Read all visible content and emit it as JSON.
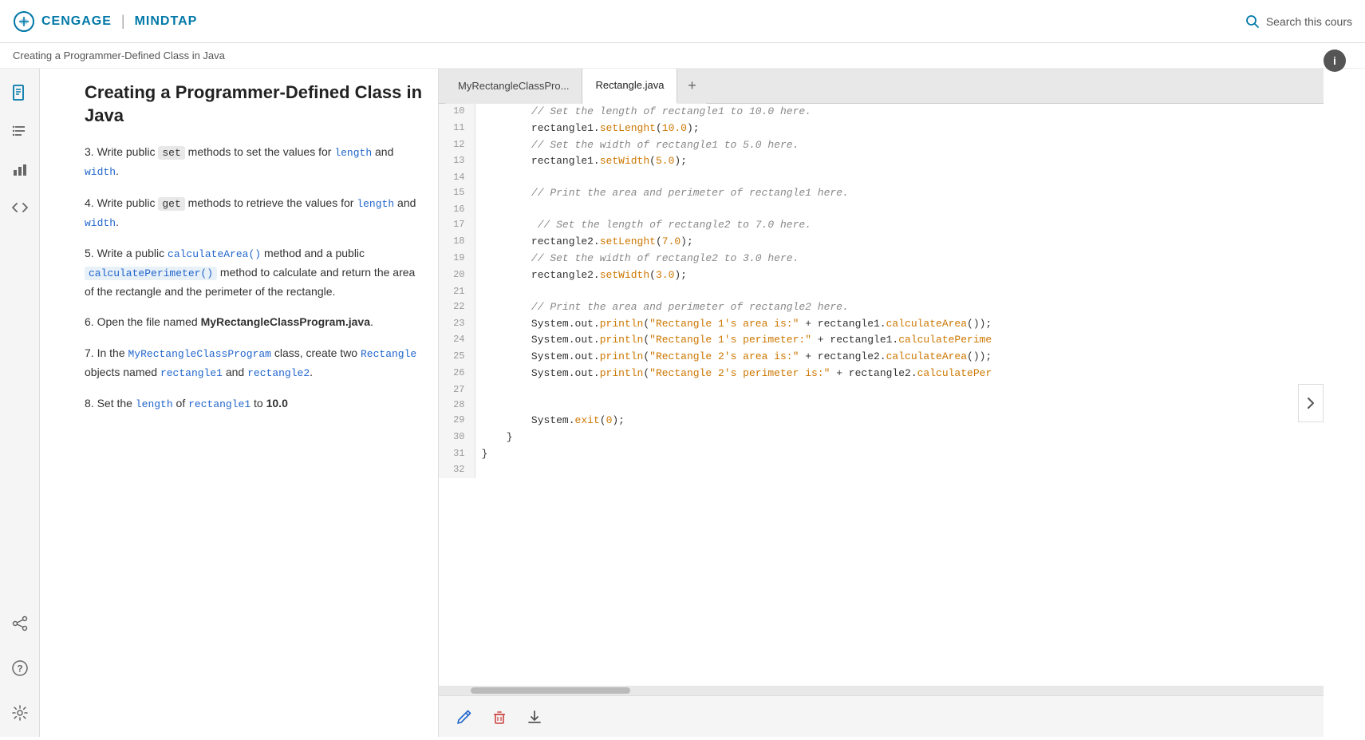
{
  "header": {
    "logo_cengage": "CENGAGE",
    "logo_mindtap": "MINDTAP",
    "search_placeholder": "Search this cours"
  },
  "breadcrumb": {
    "text": "Creating a Programmer-Defined Class in Java"
  },
  "content": {
    "title": "Creating a Programmer-Defined Class in Java",
    "items": [
      {
        "number": "3",
        "text_parts": [
          {
            "type": "text",
            "val": "Write public "
          },
          {
            "type": "code",
            "val": "set"
          },
          {
            "type": "text",
            "val": " methods to set the values for "
          },
          {
            "type": "blue",
            "val": "length"
          },
          {
            "type": "text",
            "val": " and "
          },
          {
            "type": "blue",
            "val": "width"
          },
          {
            "type": "text",
            "val": "."
          }
        ]
      },
      {
        "number": "4",
        "text_parts": [
          {
            "type": "text",
            "val": "Write public "
          },
          {
            "type": "code",
            "val": "get"
          },
          {
            "type": "text",
            "val": " methods to retrieve the values for "
          },
          {
            "type": "blue",
            "val": "length"
          },
          {
            "type": "text",
            "val": " and "
          },
          {
            "type": "blue",
            "val": "width"
          },
          {
            "type": "text",
            "val": "."
          }
        ]
      },
      {
        "number": "5",
        "text_parts": [
          {
            "type": "text",
            "val": "Write a public "
          },
          {
            "type": "blue-code",
            "val": "calculateArea()"
          },
          {
            "type": "text",
            "val": " method and a public "
          },
          {
            "type": "blue-code-block",
            "val": "calculatePerimeter()"
          },
          {
            "type": "text",
            "val": " method to calculate and return the area of the rectangle and the perimeter of the rectangle."
          }
        ]
      },
      {
        "number": "6",
        "text_parts": [
          {
            "type": "text",
            "val": "Open the file named "
          },
          {
            "type": "bold",
            "val": "MyRectangleClassProgram.java"
          },
          {
            "type": "text",
            "val": "."
          }
        ]
      },
      {
        "number": "7",
        "text_parts": [
          {
            "type": "text",
            "val": "In the "
          },
          {
            "type": "blue",
            "val": "MyRectangleClassProgram"
          },
          {
            "type": "text",
            "val": " class, create two "
          },
          {
            "type": "blue",
            "val": "Rectangle"
          },
          {
            "type": "text",
            "val": " objects named "
          },
          {
            "type": "blue",
            "val": "rectangle1"
          },
          {
            "type": "text",
            "val": " and "
          },
          {
            "type": "blue",
            "val": "rectangle2"
          },
          {
            "type": "text",
            "val": "."
          }
        ]
      },
      {
        "number": "8",
        "text_parts": [
          {
            "type": "text",
            "val": "Set the "
          },
          {
            "type": "blue",
            "val": "length"
          },
          {
            "type": "text",
            "val": " of "
          },
          {
            "type": "blue",
            "val": "rectangle1"
          },
          {
            "type": "text",
            "val": " to "
          },
          {
            "type": "bold",
            "val": "10.0"
          }
        ]
      }
    ]
  },
  "tabs": [
    {
      "label": "MyRectangleClassPro...",
      "active": false
    },
    {
      "label": "Rectangle.java",
      "active": true
    }
  ],
  "tab_add": "+",
  "code_lines": [
    {
      "num": "10",
      "code": [
        {
          "type": "comment",
          "val": "        // Set the length of rectangle1 to 10.0 here."
        }
      ]
    },
    {
      "num": "11",
      "code": [
        {
          "type": "default",
          "val": "        rectangle1."
        },
        {
          "type": "method",
          "val": "setLenght"
        },
        {
          "type": "default",
          "val": "("
        },
        {
          "type": "num",
          "val": "10.0"
        },
        {
          "type": "default",
          "val": ");"
        }
      ]
    },
    {
      "num": "12",
      "code": [
        {
          "type": "comment",
          "val": "        // Set the width of rectangle1 to 5.0 here."
        }
      ]
    },
    {
      "num": "13",
      "code": [
        {
          "type": "default",
          "val": "        rectangle1."
        },
        {
          "type": "method",
          "val": "setWidth"
        },
        {
          "type": "default",
          "val": "("
        },
        {
          "type": "num",
          "val": "5.0"
        },
        {
          "type": "default",
          "val": ");"
        }
      ]
    },
    {
      "num": "14",
      "code": [
        {
          "type": "default",
          "val": ""
        }
      ]
    },
    {
      "num": "15",
      "code": [
        {
          "type": "comment",
          "val": "        // Print the area and perimeter of rectangle1 here."
        }
      ]
    },
    {
      "num": "16",
      "code": [
        {
          "type": "default",
          "val": ""
        }
      ]
    },
    {
      "num": "17",
      "code": [
        {
          "type": "comment",
          "val": "         // Set the length of rectangle2 to 7.0 here."
        }
      ]
    },
    {
      "num": "18",
      "code": [
        {
          "type": "default",
          "val": "        rectangle2."
        },
        {
          "type": "method",
          "val": "setLenght"
        },
        {
          "type": "default",
          "val": "("
        },
        {
          "type": "num",
          "val": "7.0"
        },
        {
          "type": "default",
          "val": ");"
        }
      ]
    },
    {
      "num": "19",
      "code": [
        {
          "type": "comment",
          "val": "        // Set the width of rectangle2 to 3.0 here."
        }
      ]
    },
    {
      "num": "20",
      "code": [
        {
          "type": "default",
          "val": "        rectangle2."
        },
        {
          "type": "method",
          "val": "setWidth"
        },
        {
          "type": "default",
          "val": "("
        },
        {
          "type": "num",
          "val": "3.0"
        },
        {
          "type": "default",
          "val": ");"
        }
      ]
    },
    {
      "num": "21",
      "code": [
        {
          "type": "default",
          "val": ""
        }
      ]
    },
    {
      "num": "22",
      "code": [
        {
          "type": "comment",
          "val": "        // Print the area and perimeter of rectangle2 here."
        }
      ]
    },
    {
      "num": "23",
      "code": [
        {
          "type": "default",
          "val": "        System.out."
        },
        {
          "type": "method",
          "val": "println"
        },
        {
          "type": "default",
          "val": "("
        },
        {
          "type": "string",
          "val": "\"Rectangle 1's area is:\""
        },
        {
          "type": "default",
          "val": " + rectangle1."
        },
        {
          "type": "method",
          "val": "calculateArea"
        },
        {
          "type": "default",
          "val": "());"
        }
      ]
    },
    {
      "num": "24",
      "code": [
        {
          "type": "default",
          "val": "        System.out."
        },
        {
          "type": "method",
          "val": "println"
        },
        {
          "type": "default",
          "val": "("
        },
        {
          "type": "string",
          "val": "\"Rectangle 1's perimeter:\""
        },
        {
          "type": "default",
          "val": " + rectangle1."
        },
        {
          "type": "method",
          "val": "calculatePerime"
        }
      ]
    },
    {
      "num": "25",
      "code": [
        {
          "type": "default",
          "val": "        System.out."
        },
        {
          "type": "method",
          "val": "println"
        },
        {
          "type": "default",
          "val": "("
        },
        {
          "type": "string",
          "val": "\"Rectangle 2's area is:\""
        },
        {
          "type": "default",
          "val": " + rectangle2."
        },
        {
          "type": "method",
          "val": "calculateArea"
        },
        {
          "type": "default",
          "val": "());"
        }
      ]
    },
    {
      "num": "26",
      "code": [
        {
          "type": "default",
          "val": "        System.out."
        },
        {
          "type": "method",
          "val": "println"
        },
        {
          "type": "default",
          "val": "("
        },
        {
          "type": "string",
          "val": "\"Rectangle 2's perimeter is:\""
        },
        {
          "type": "default",
          "val": " + rectangle2."
        },
        {
          "type": "method",
          "val": "calculatePer"
        }
      ]
    },
    {
      "num": "27",
      "code": [
        {
          "type": "default",
          "val": ""
        }
      ]
    },
    {
      "num": "28",
      "code": [
        {
          "type": "default",
          "val": ""
        }
      ]
    },
    {
      "num": "29",
      "code": [
        {
          "type": "default",
          "val": "        System."
        },
        {
          "type": "method",
          "val": "exit"
        },
        {
          "type": "default",
          "val": "("
        },
        {
          "type": "num",
          "val": "0"
        },
        {
          "type": "default",
          "val": ");"
        }
      ]
    },
    {
      "num": "30",
      "code": [
        {
          "type": "default",
          "val": "    }"
        }
      ]
    },
    {
      "num": "31",
      "code": [
        {
          "type": "default",
          "val": "}"
        }
      ]
    },
    {
      "num": "32",
      "code": [
        {
          "type": "default",
          "val": ""
        }
      ]
    }
  ],
  "toolbar": {
    "pencil_title": "Edit",
    "trash_title": "Delete",
    "download_title": "Download"
  }
}
